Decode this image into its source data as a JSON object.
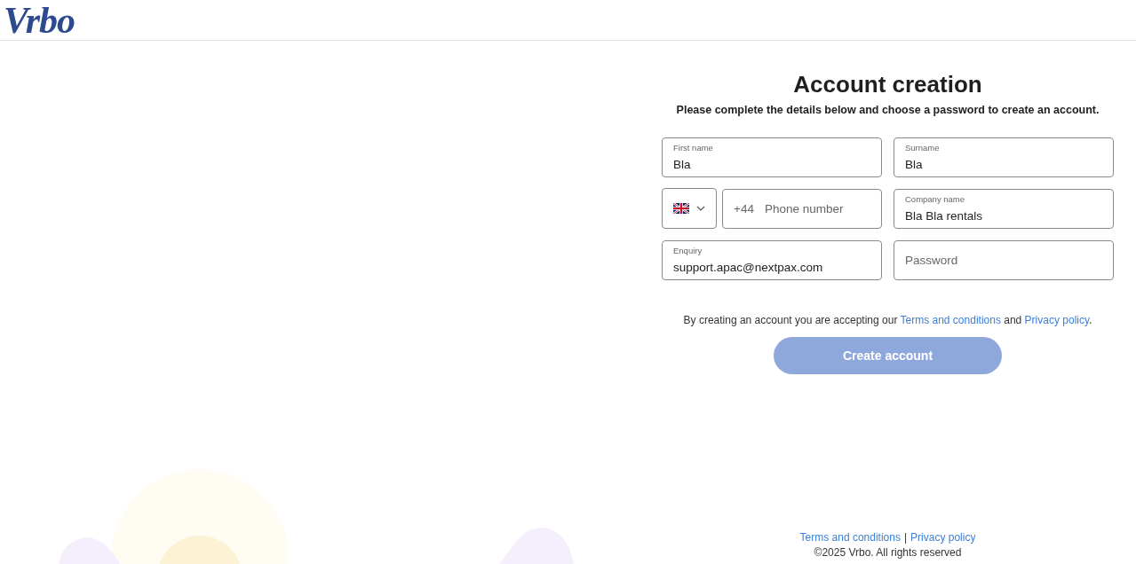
{
  "header": {
    "logo": "Vrbo"
  },
  "form": {
    "title": "Account creation",
    "subtitle": "Please complete the details below and choose a password to create an account.",
    "rows": [
      [
        {
          "kind": "text",
          "label": "First name",
          "value": "Bla"
        },
        {
          "kind": "text",
          "label": "Surname",
          "value": "Bla"
        }
      ],
      [
        {
          "kind": "phone",
          "prefix": "+44",
          "placeholder": "Phone number"
        },
        {
          "kind": "text",
          "label": "Company name",
          "value": "Bla Bla rentals"
        }
      ],
      [
        {
          "kind": "text",
          "label": "Enquiry",
          "value": "support.apac@nextpax.com"
        },
        {
          "kind": "password",
          "placeholder": "Password"
        }
      ]
    ],
    "consent": {
      "before": "By creating an account you are accepting our ",
      "link1": "Terms and conditions",
      "middle": " and ",
      "link2": "Privacy policy",
      "after": "."
    },
    "submit": {
      "label": "Create account",
      "disabled": true
    }
  },
  "footer": {
    "links": [
      "Terms and conditions",
      "Privacy policy"
    ],
    "separator": "|",
    "copyright": "©2025 Vrbo. All rights reserved"
  }
}
